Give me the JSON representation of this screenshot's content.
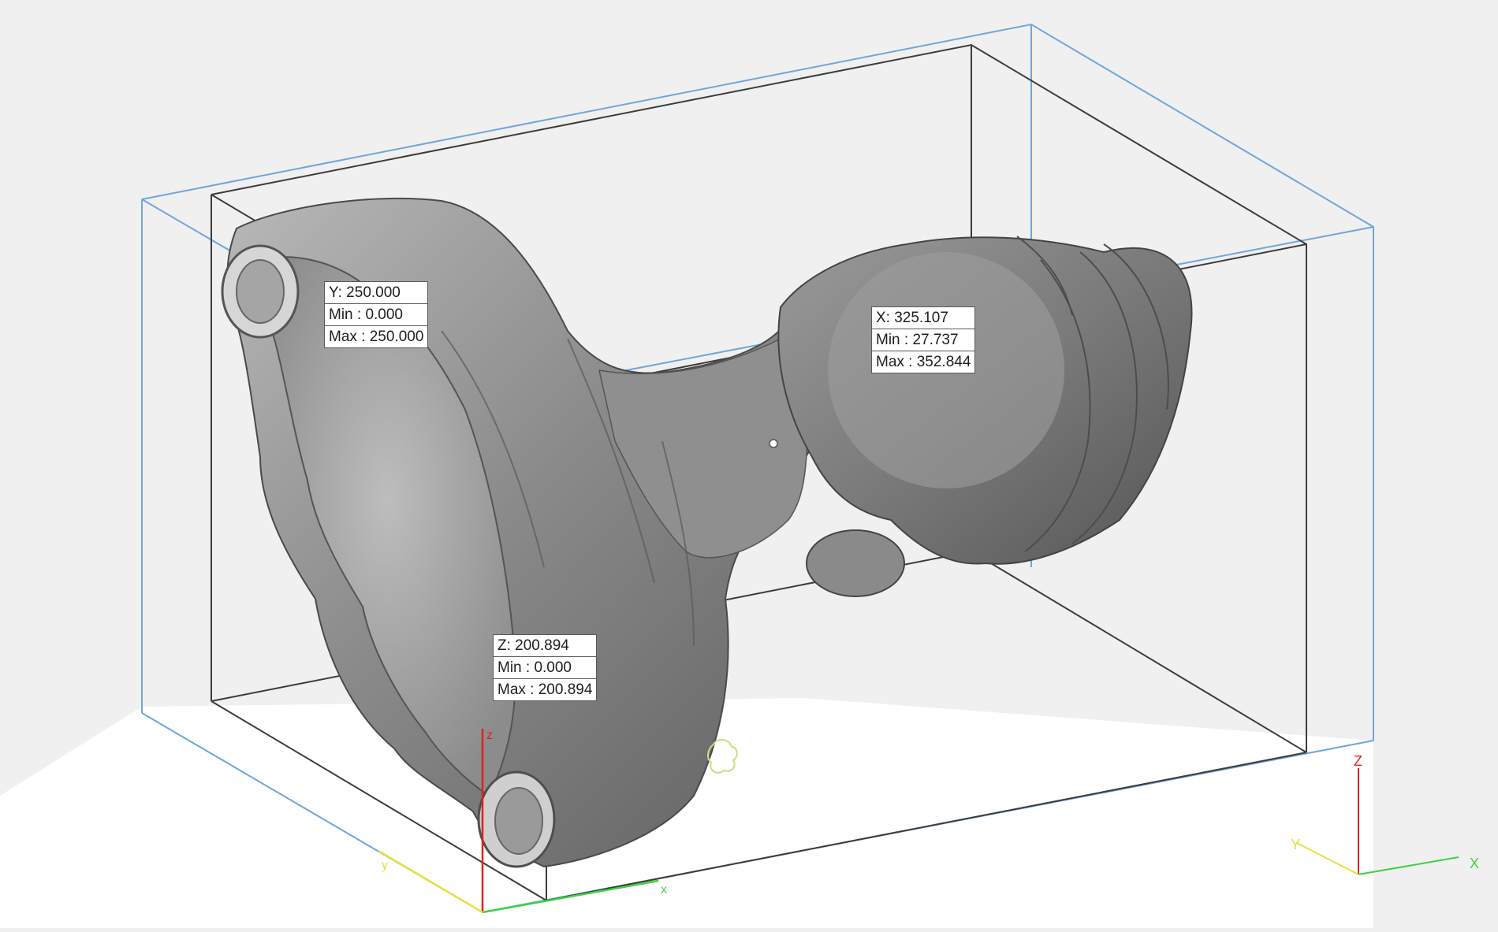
{
  "dimensions": {
    "y": {
      "value": "Y: 250.000",
      "min": "Min : 0.000",
      "max": "Max : 250.000"
    },
    "x": {
      "value": "X: 325.107",
      "min": "Min : 27.737",
      "max": "Max : 352.844"
    },
    "z": {
      "value": "Z: 200.894",
      "min": "Min : 0.000",
      "max": "Max : 200.894"
    }
  },
  "scene_axes": {
    "x": "x",
    "y": "y",
    "z": "z"
  },
  "triad_axes": {
    "x": "X",
    "y": "Y",
    "z": "Z"
  },
  "colors": {
    "background": "#f0f0f0",
    "floor": "#ffffff",
    "outer_bounding_box": "#6fa6dc",
    "inner_bounding_box": "#3c3c3c",
    "x_axis": "#40d040",
    "y_axis": "#e8e040",
    "z_axis": "#e02020",
    "mesh": "#8a8a8a"
  },
  "icons": {
    "model": "bust-mesh",
    "pivot": "pivot-point-icon",
    "marker": "cursor-marker-icon",
    "triad": "axis-triad-icon"
  }
}
